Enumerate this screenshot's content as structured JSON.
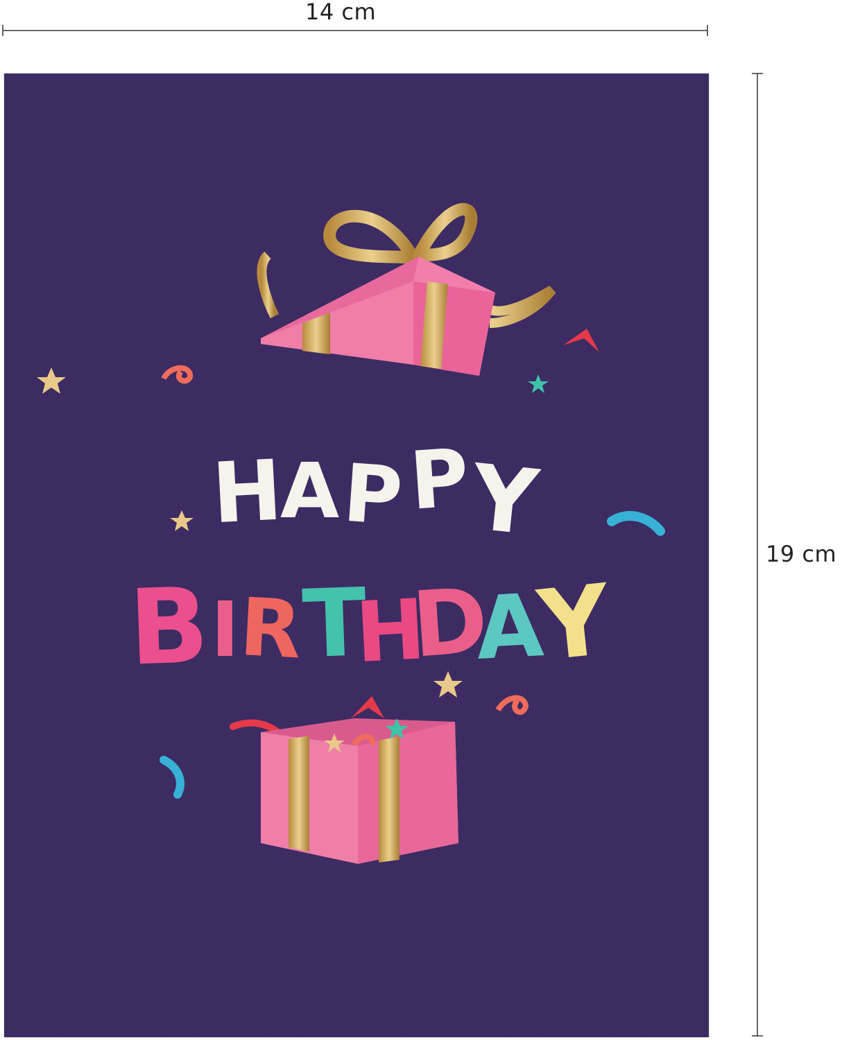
{
  "dimensions": {
    "width": "14 cm",
    "height": "19 cm"
  },
  "card": {
    "background_color": "#3b2b62",
    "greeting_line1": [
      "H",
      "A",
      "P",
      "P",
      "Y"
    ],
    "greeting_line2": [
      "B",
      "I",
      "R",
      "T",
      "H",
      "D",
      "A",
      "Y"
    ],
    "line1_color": "#f6f3ec",
    "line2_colors": [
      "#ec4f8d",
      "#ea5f8a",
      "#ef6560",
      "#45c2ac",
      "#e94a84",
      "#ea5f8a",
      "#5cc8c1",
      "#f2e18a"
    ],
    "gift_colors": {
      "box": "#ef7ea8",
      "box_side": "#e8689a",
      "ribbon": "#c9a55a"
    },
    "icons": [
      "gift-lid-icon",
      "gift-box-icon",
      "star-icon",
      "confetti-icon"
    ]
  }
}
